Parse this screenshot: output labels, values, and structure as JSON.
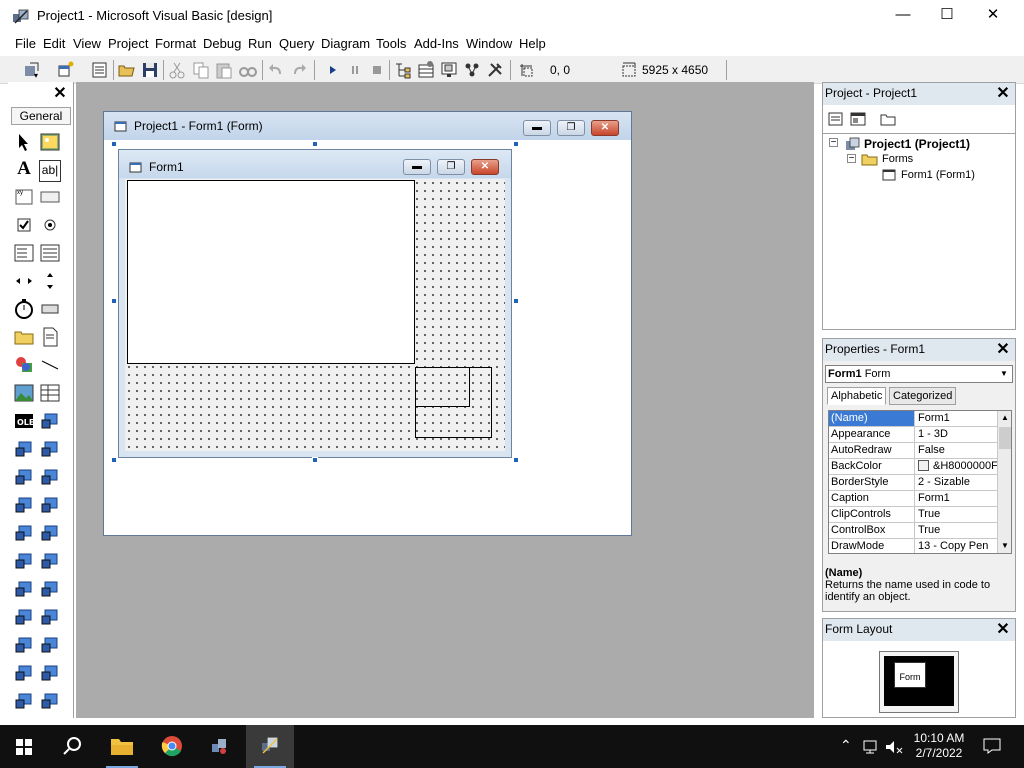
{
  "window": {
    "title": "Project1 - Microsoft Visual Basic [design]",
    "minimize": "—",
    "maximize": "☐",
    "close": "✕"
  },
  "menu": [
    "File",
    "Edit",
    "View",
    "Project",
    "Format",
    "Debug",
    "Run",
    "Query",
    "Diagram",
    "Tools",
    "Add-Ins",
    "Window",
    "Help"
  ],
  "toolbar": {
    "position": "0, 0",
    "size": "5925 x 4650"
  },
  "toolbox": {
    "close": "✕",
    "tab_label": "General",
    "label_tool_glyph": "A",
    "textbox_tool_glyph": "ab|"
  },
  "designer": {
    "title": "Project1 - Form1 (Form)"
  },
  "form": {
    "caption": "Form1"
  },
  "project_explorer": {
    "title": "Project - Project1",
    "close": "✕",
    "tree": {
      "project": "Project1 (Project1)",
      "folder": "Forms",
      "form": "Form1 (Form1)"
    }
  },
  "properties": {
    "title": "Properties - Form1",
    "close": "✕",
    "object_name": "Form1",
    "object_type": "Form",
    "tabs": [
      "Alphabetic",
      "Categorized"
    ],
    "rows": [
      {
        "name": "(Name)",
        "value": "Form1"
      },
      {
        "name": "Appearance",
        "value": "1 - 3D"
      },
      {
        "name": "AutoRedraw",
        "value": "False"
      },
      {
        "name": "BackColor",
        "value": "&H8000000F"
      },
      {
        "name": "BorderStyle",
        "value": "2 - Sizable"
      },
      {
        "name": "Caption",
        "value": "Form1"
      },
      {
        "name": "ClipControls",
        "value": "True"
      },
      {
        "name": "ControlBox",
        "value": "True"
      },
      {
        "name": "DrawMode",
        "value": "13 - Copy Pen"
      }
    ],
    "description_name": "(Name)",
    "description_text": "Returns the name used in code to identify an object."
  },
  "form_layout": {
    "title": "Form Layout",
    "close": "✕",
    "preview_label": "Form"
  },
  "taskbar": {
    "time": "10:10 AM",
    "date": "2/7/2022"
  },
  "colors": {
    "selection": "#3a7ad4",
    "workspace": "#ababab",
    "handle": "#1e63b8",
    "taskbar": "#101010"
  }
}
